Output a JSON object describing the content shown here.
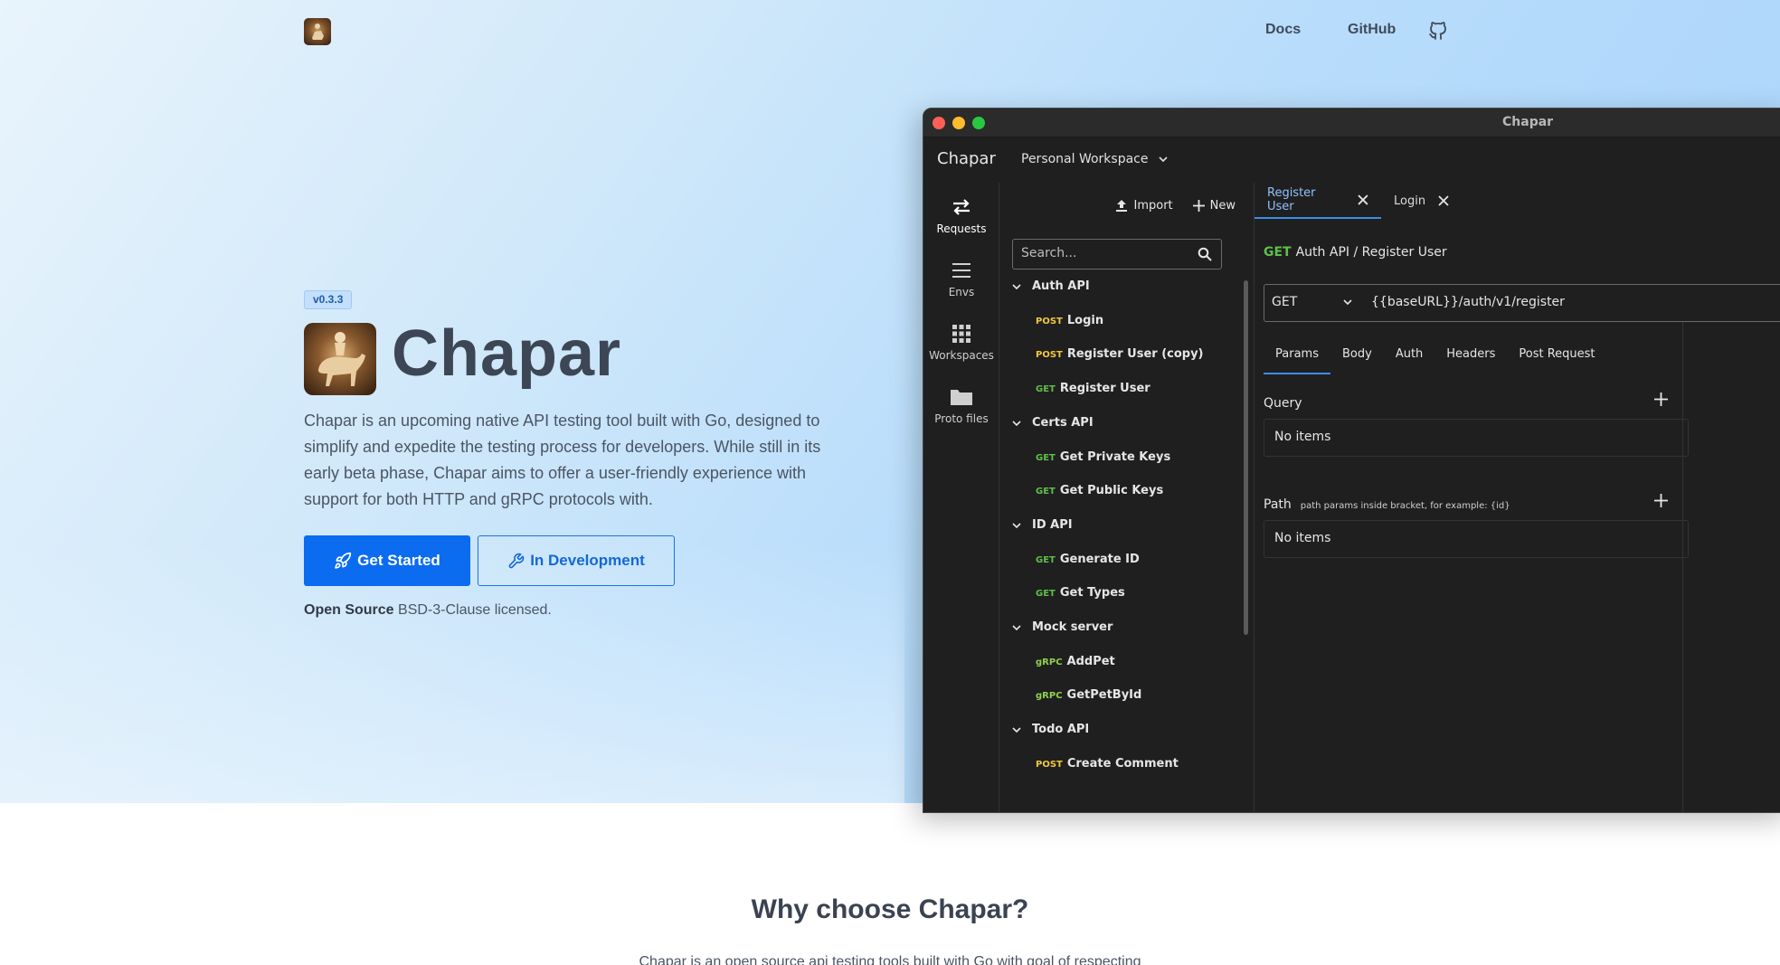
{
  "nav": {
    "docs": "Docs",
    "github": "GitHub",
    "icons": [
      "logo",
      "github-icon"
    ]
  },
  "hero": {
    "version": "v0.3.3",
    "title": "Chapar",
    "description": "Chapar is an upcoming native API testing tool built with Go, designed to simplify and expedite the testing process for developers. While still in its early beta phase, Chapar aims to offer a user-friendly experience with support for both HTTP and gRPC protocols with.",
    "get_started": "Get Started",
    "in_development": "In Development",
    "license_bold": "Open Source",
    "license_rest": " BSD-3-Clause licensed."
  },
  "app": {
    "window_title": "Chapar",
    "app_name": "Chapar",
    "workspace": "Personal Workspace",
    "rail": {
      "requests": "Requests",
      "envs": "Envs",
      "workspaces": "Workspaces",
      "proto": "Proto files"
    },
    "toolbar": {
      "import": "Import",
      "new": "New"
    },
    "search_placeholder": "Search...",
    "tree": [
      {
        "type": "folder",
        "label": "Auth API"
      },
      {
        "type": "leaf",
        "method": "POST",
        "label": "Login"
      },
      {
        "type": "leaf",
        "method": "POST",
        "label": "Register User (copy)"
      },
      {
        "type": "leaf",
        "method": "GET",
        "label": "Register User"
      },
      {
        "type": "folder",
        "label": "Certs API"
      },
      {
        "type": "leaf",
        "method": "GET",
        "label": "Get Private Keys"
      },
      {
        "type": "leaf",
        "method": "GET",
        "label": "Get Public Keys"
      },
      {
        "type": "folder",
        "label": "ID API"
      },
      {
        "type": "leaf",
        "method": "GET",
        "label": "Generate ID"
      },
      {
        "type": "leaf",
        "method": "GET",
        "label": "Get Types"
      },
      {
        "type": "folder",
        "label": "Mock server"
      },
      {
        "type": "leaf",
        "method": "gRPC",
        "label": "AddPet"
      },
      {
        "type": "leaf",
        "method": "gRPC",
        "label": "GetPetById"
      },
      {
        "type": "folder",
        "label": "Todo API"
      },
      {
        "type": "leaf",
        "method": "POST",
        "label": "Create Comment"
      }
    ],
    "tabs": [
      "Register User",
      "Login"
    ],
    "breadcrumb": {
      "method": "GET",
      "path": "Auth API / ",
      "name": "Register User"
    },
    "url": {
      "method": "GET",
      "value": "{{baseURL}}/auth/v1/register"
    },
    "request_tabs": [
      "Params",
      "Body",
      "Auth",
      "Headers",
      "Post Request"
    ],
    "query_label": "Query",
    "path_label": "Path",
    "path_hint": "path params inside bracket, for example: {id}",
    "no_items": "No items",
    "colors": {
      "post": "#f0c83d",
      "get": "#5fbf4a",
      "grpc": "#8fd14f",
      "accent": "#3b8ee8"
    }
  },
  "why": {
    "title": "Why choose Chapar?",
    "description": "Chapar is an open source api testing tools built with Go with goal of respecting"
  }
}
